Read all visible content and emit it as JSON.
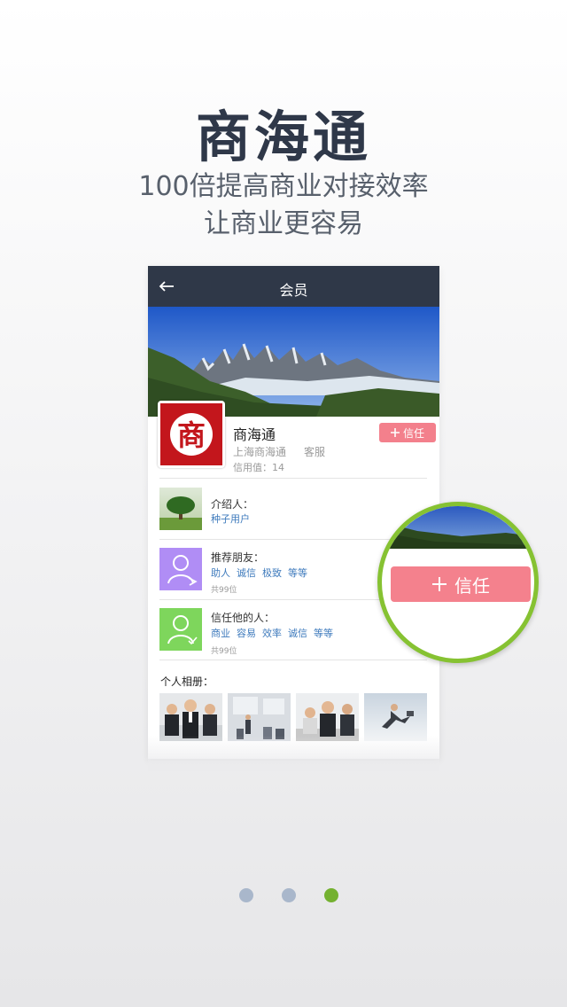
{
  "hero": {
    "title": "商海通",
    "subtitle_1": "100倍提高商业对接效率",
    "subtitle_2": "让商业更容易"
  },
  "navbar": {
    "title": "会员",
    "back_icon": "arrow-left-icon"
  },
  "profile": {
    "name": "商海通",
    "company": "上海商海通",
    "role": "客服",
    "credit": "信用值：14",
    "logo_char": "商",
    "trust_button": "信任",
    "trust_icon": "plus-icon"
  },
  "rows": [
    {
      "label": "介绍人：",
      "tags": [
        "种子用户"
      ],
      "count": ""
    },
    {
      "label": "推荐朋友：",
      "tags": [
        "助人",
        "诚信",
        "极致",
        "等等"
      ],
      "count": "共99位"
    },
    {
      "label": "信任他的人：",
      "tags": [
        "商业",
        "容易",
        "效率",
        "诚信",
        "等等"
      ],
      "count": "共99位"
    }
  ],
  "album": {
    "title": "个人相册："
  },
  "zoom_callout": {
    "button": "信任"
  },
  "pager": {
    "count": 3,
    "active_index": 2
  },
  "colors": {
    "navbar": "#2f3848",
    "trust_button": "#f3808c",
    "tag_link": "#3f7bbd",
    "accent_green": "#86c232",
    "dot_inactive": "#a9b7cb",
    "dot_active": "#74b130"
  }
}
